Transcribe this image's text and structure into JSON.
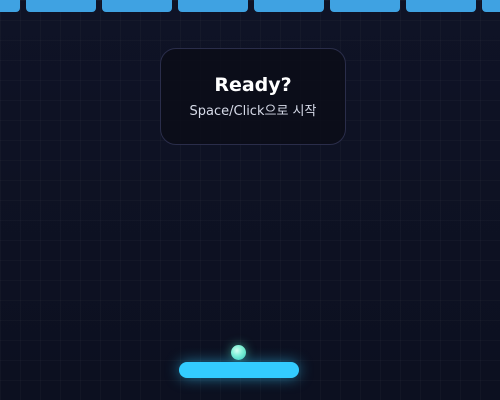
{
  "overlay": {
    "title": "Ready?",
    "subtitle": "Space/Click으로 시작"
  },
  "colors": {
    "background": "#0c1020",
    "brick": "#3fa2e2",
    "paddle": "#33ccff",
    "ball": "#86f3d6",
    "overlay_border": "#2a2d4a"
  },
  "bricks": {
    "visible_count": 7
  }
}
